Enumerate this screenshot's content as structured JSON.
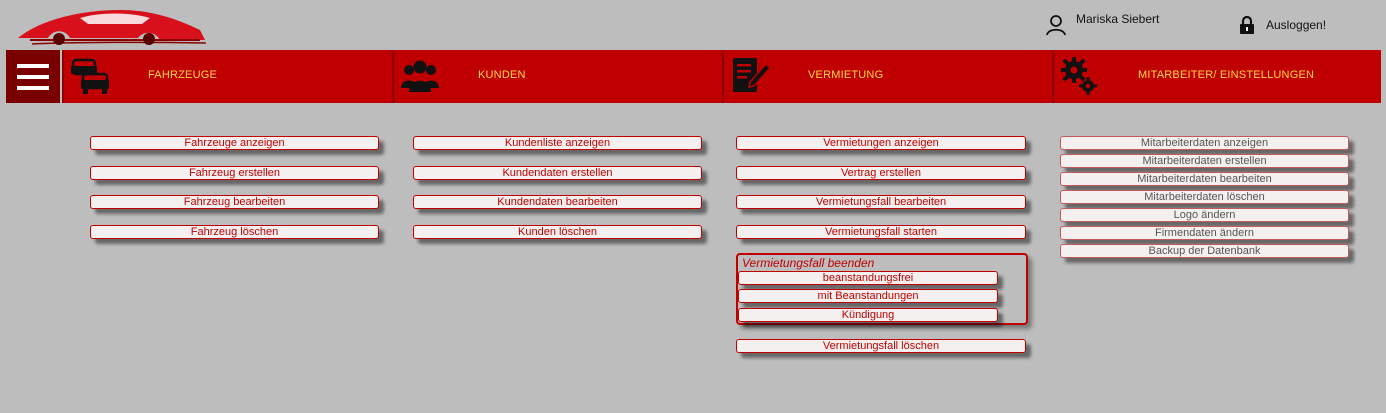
{
  "header": {
    "user_name": "Mariska Siebert",
    "user_icon": "user-icon",
    "logout_label": "Ausloggen!",
    "logout_icon": "lock-icon",
    "logo_icon": "car-logo-icon"
  },
  "nav": {
    "menu_icon": "hamburger-menu-icon",
    "items": [
      {
        "label": "FAHRZEUGE",
        "icon": "cars-icon"
      },
      {
        "label": "KUNDEN",
        "icon": "users-icon"
      },
      {
        "label": "VERMIETUNG",
        "icon": "contract-edit-icon"
      },
      {
        "label": "MITARBEITER/ EINSTELLUNGEN",
        "icon": "gears-icon"
      }
    ]
  },
  "fahrzeuge": {
    "buttons": [
      "Fahrzeuge anzeigen",
      "Fahrzeug erstellen",
      "Fahrzeug bearbeiten",
      "Fahrzeug löschen"
    ]
  },
  "kunden": {
    "buttons": [
      "Kundenliste anzeigen",
      "Kundendaten erstellen",
      "Kundendaten bearbeiten",
      "Kunden löschen"
    ]
  },
  "vermietung": {
    "buttons": [
      "Vermietungen anzeigen",
      "Vertrag erstellen",
      "Vermietungsfall bearbeiten",
      "Vermietungsfall starten"
    ],
    "beenden_title": "Vermietungsfall beenden",
    "beenden_options": [
      "beanstandungsfrei",
      "mit Beanstandungen",
      "Kündigung"
    ],
    "delete_label": "Vermietungsfall löschen"
  },
  "mitarbeiter": {
    "buttons": [
      "Mitarbeiterdaten anzeigen",
      "Mitarbeiterdaten erstellen",
      "Mitarbeiterdaten bearbeiten",
      "Mitarbeiterdaten löschen",
      "Logo ändern",
      "Firmendaten ändern",
      "Backup der Datenbank"
    ]
  },
  "colors": {
    "nav_red": "#c00000",
    "nav_dark": "#7a0000",
    "nav_text": "#ffd84a",
    "background": "#bdbdbd"
  }
}
